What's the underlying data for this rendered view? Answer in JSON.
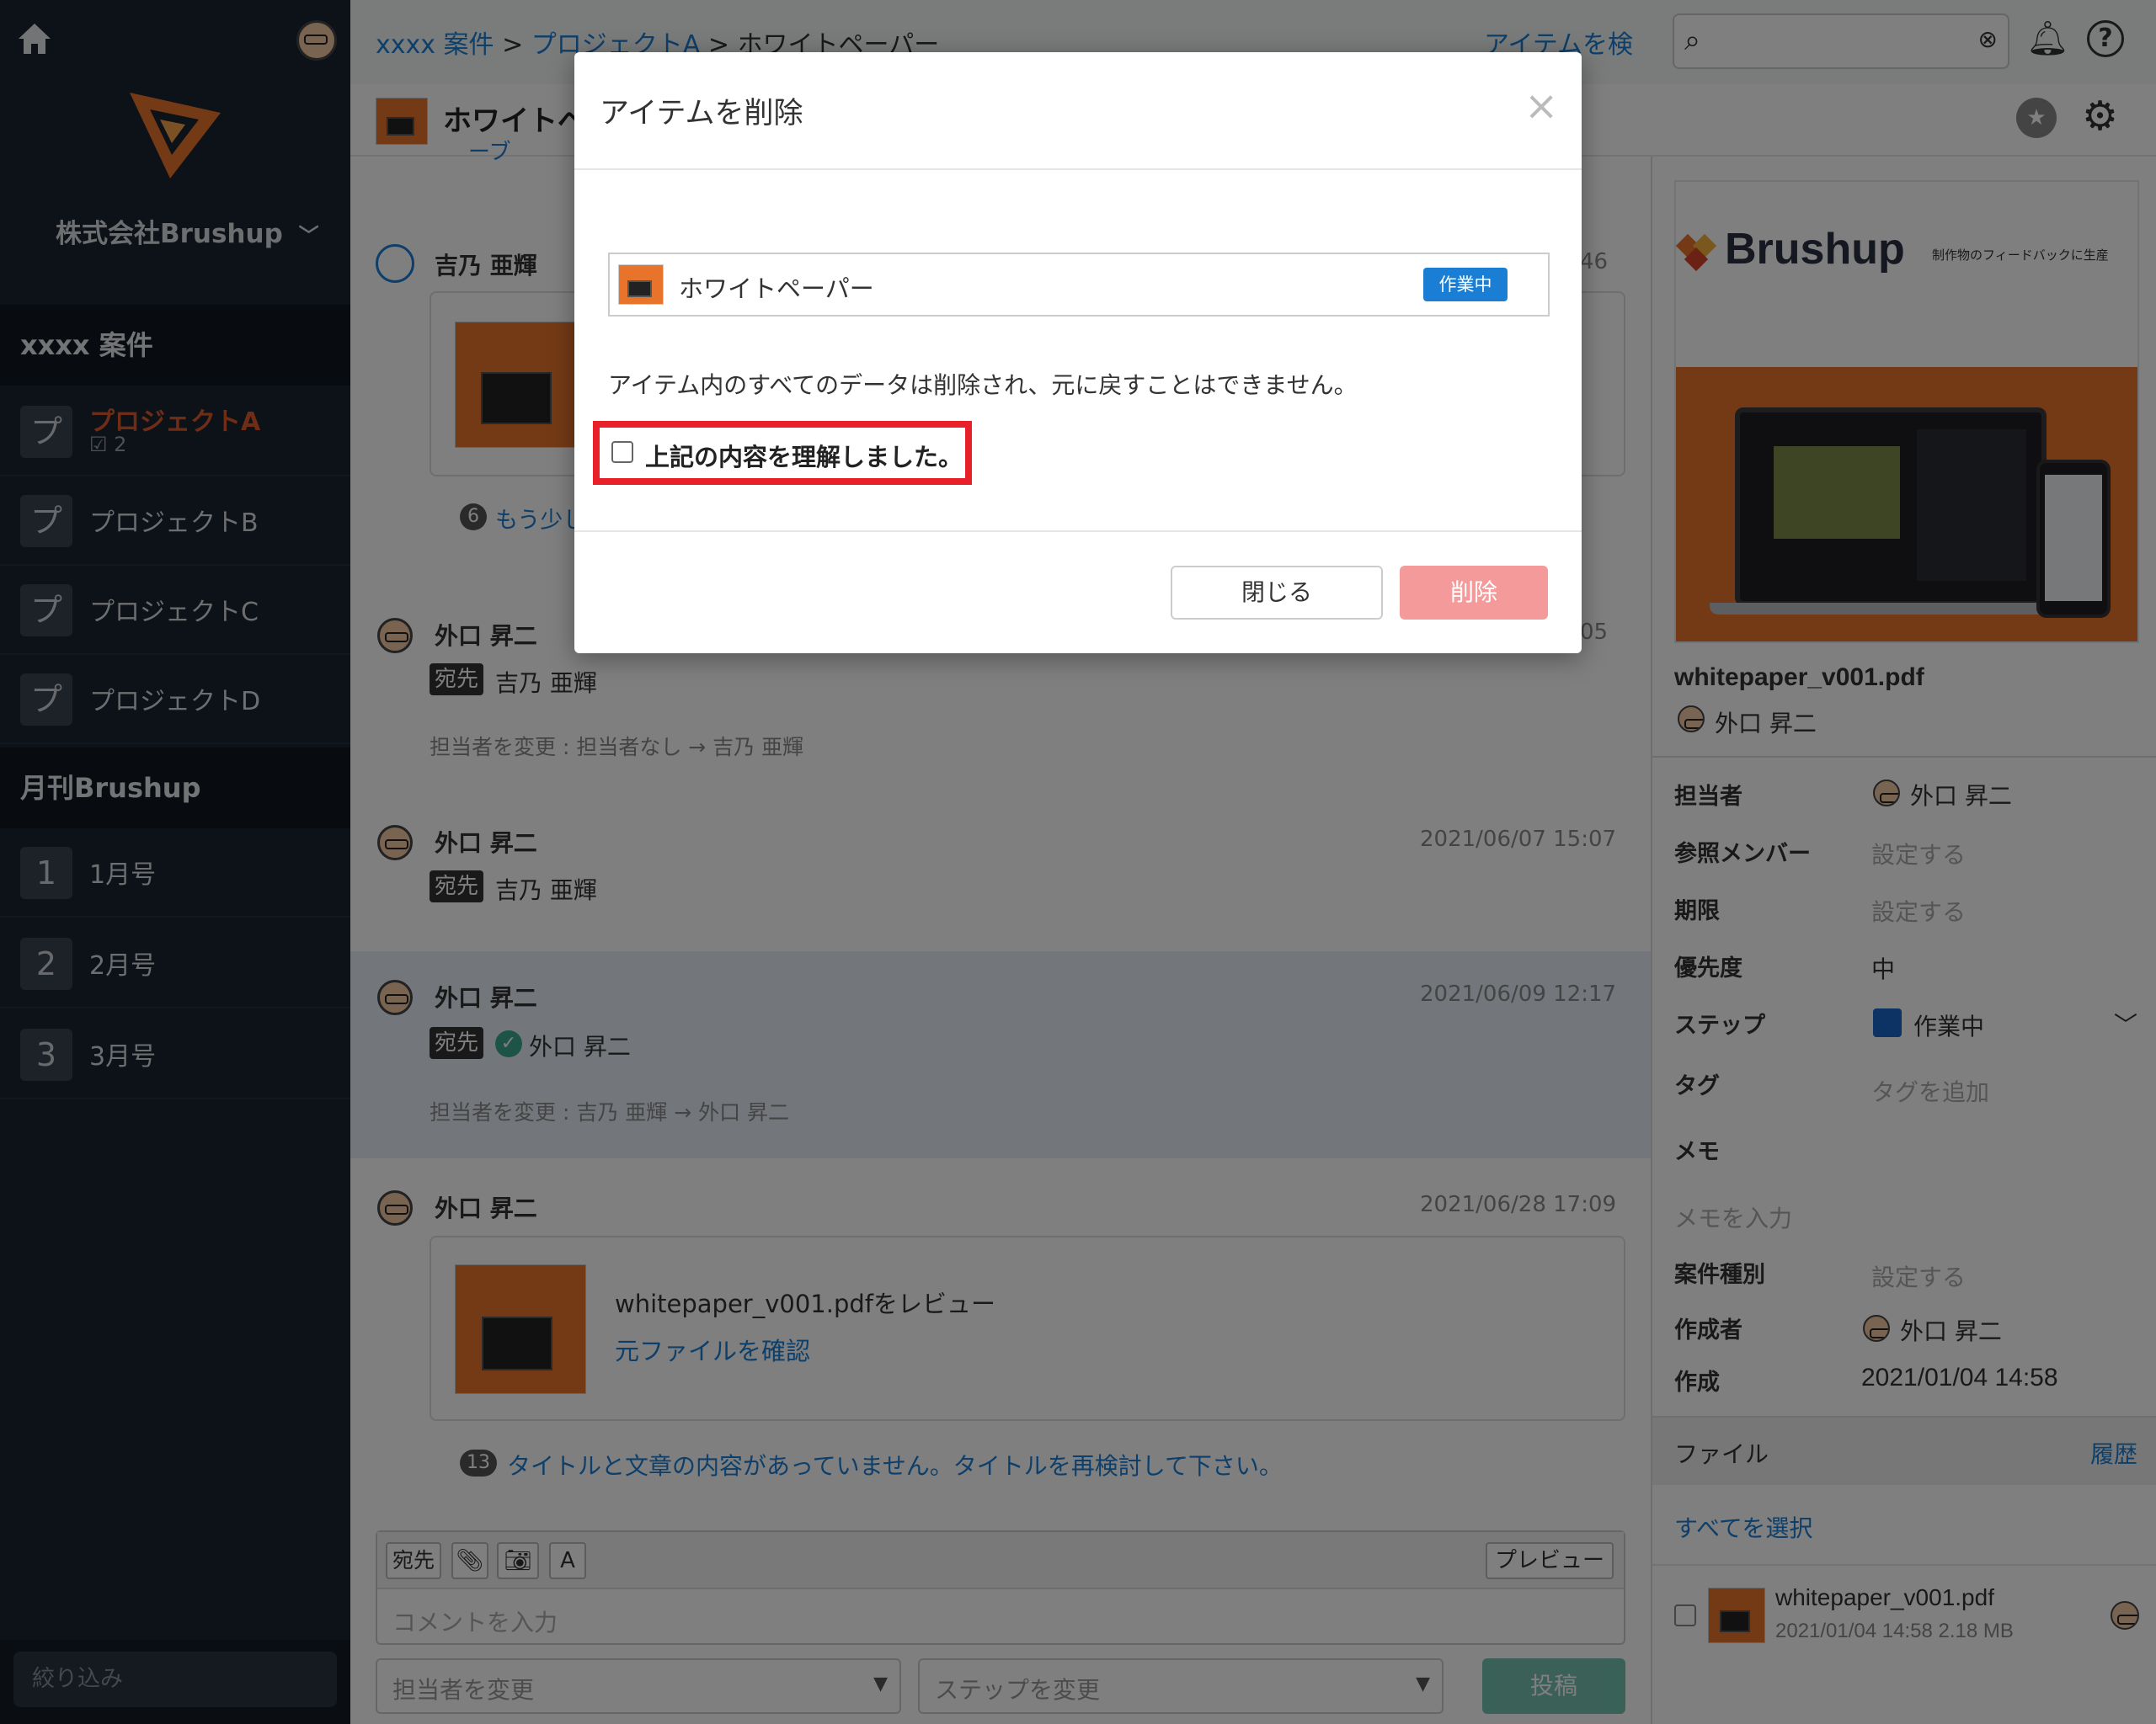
{
  "sidebar": {
    "company": "株式会社Brushup",
    "section1": "xxxx 案件",
    "projects": [
      {
        "icon": "プ",
        "label": "プロジェクトA",
        "sub": "2"
      },
      {
        "icon": "プ",
        "label": "プロジェクトB"
      },
      {
        "icon": "プ",
        "label": "プロジェクトC"
      },
      {
        "icon": "プ",
        "label": "プロジェクトD"
      }
    ],
    "section2": "月刊Brushup",
    "issues": [
      {
        "icon": "1",
        "label": "1月号"
      },
      {
        "icon": "2",
        "label": "2月号"
      },
      {
        "icon": "3",
        "label": "3月号"
      }
    ],
    "filter_placeholder": "絞り込み"
  },
  "header": {
    "bc1": "xxxx 案件",
    "sep": ">",
    "bc2": "プロジェクトA",
    "bc3": "ホワイトペーパー",
    "search_label": "アイテムを検索",
    "title": "ホワイトペ",
    "back_fragment": "ーブ"
  },
  "thread": {
    "c1": {
      "user": "吉乃 亜輝",
      "time_frag": "46",
      "more_count": "6",
      "more_text": "もう少し"
    },
    "c2": {
      "user": "外口 昇二",
      "time_frag": "05",
      "to": "宛先",
      "recipient": "吉乃 亜輝",
      "note": "担当者を変更 : 担当者なし → 吉乃 亜輝"
    },
    "c3": {
      "user": "外口 昇二",
      "time": "2021/06/07 15:07",
      "to": "宛先",
      "recipient": "吉乃 亜輝"
    },
    "c4": {
      "user": "外口 昇二",
      "time": "2021/06/09 12:17",
      "to": "宛先",
      "recipient": "外口 昇二",
      "note": "担当者を変更 : 吉乃 亜輝 → 外口 昇二"
    },
    "c5": {
      "user": "外口 昇二",
      "time": "2021/06/28 17:09",
      "review": "whitepaper_v001.pdfをレビュー",
      "link": "元ファイルを確認",
      "count": "13",
      "comment": "タイトルと文章の内容があっていません。タイトルを再検討して下さい。"
    }
  },
  "composer": {
    "to": "宛先",
    "font": "A",
    "preview": "プレビュー",
    "placeholder": "コメントを入力",
    "assignee": "担当者を変更",
    "step": "ステップを変更",
    "post": "投稿"
  },
  "right": {
    "brand": "Brushup",
    "tagline": "制作物のフィードバックに生産",
    "filename": "whitepaper_v001.pdf",
    "owner": "外口 昇二",
    "fields": {
      "assignee_label": "担当者",
      "assignee": "外口 昇二",
      "members_label": "参照メンバー",
      "members": "設定する",
      "due_label": "期限",
      "due": "設定する",
      "priority_label": "優先度",
      "priority": "中",
      "step_label": "ステップ",
      "step": "作業中",
      "tag_label": "タグ",
      "tag": "タグを追加",
      "memo_label": "メモ",
      "memo": "メモを入力",
      "type_label": "案件種別",
      "type": "設定する",
      "creator_label": "作成者",
      "creator": "外口 昇二",
      "created_label": "作成",
      "created": "2021/01/04 14:58"
    },
    "files_label": "ファイル",
    "history": "履歴",
    "select_all": "すべてを選択",
    "file": {
      "name": "whitepaper_v001.pdf",
      "meta": "2021/01/04 14:58 2.18 MB"
    }
  },
  "modal": {
    "title": "アイテムを削除",
    "close_symbol": "×",
    "item_name": "ホワイトペーパー",
    "item_status": "作業中",
    "warning": "アイテム内のすべてのデータは削除され、元に戻すことはできません。",
    "confirm": "上記の内容を理解しました。",
    "close_btn": "閉じる",
    "delete_btn": "削除"
  },
  "colors": {
    "accent": "#1a7fd4",
    "danger": "#f59a9a",
    "highlight": "#e8202a",
    "brand_orange": "#e8742c",
    "sidebar": "#1b2330",
    "active_item": "#e05a2a",
    "post_btn": "#3aa88f"
  }
}
